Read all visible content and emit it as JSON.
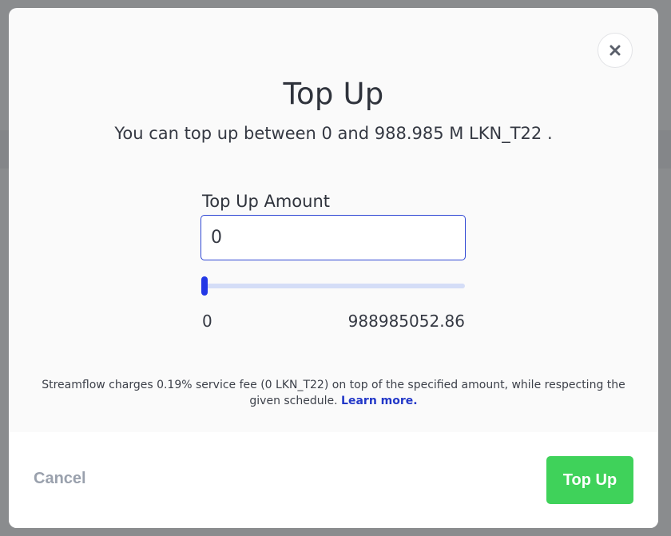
{
  "modal": {
    "title": "Top Up",
    "subtitle": "You can top up between 0 and 988.985 M LKN_T22 .",
    "amount_label": "Top Up Amount",
    "amount_value": "0",
    "slider": {
      "min_label": "0",
      "max_label": "988985052.86",
      "value_fraction": 0
    },
    "fee_note": "Streamflow charges 0.19% service fee (0 LKN_T22) on top of the specified amount, while respecting the given schedule.",
    "learn_more": "Learn more.",
    "cancel_label": "Cancel",
    "submit_label": "Top Up",
    "close_icon": "close-icon"
  },
  "colors": {
    "accent": "#2338e6",
    "submit": "#3fd25a",
    "link": "#2338c8"
  }
}
